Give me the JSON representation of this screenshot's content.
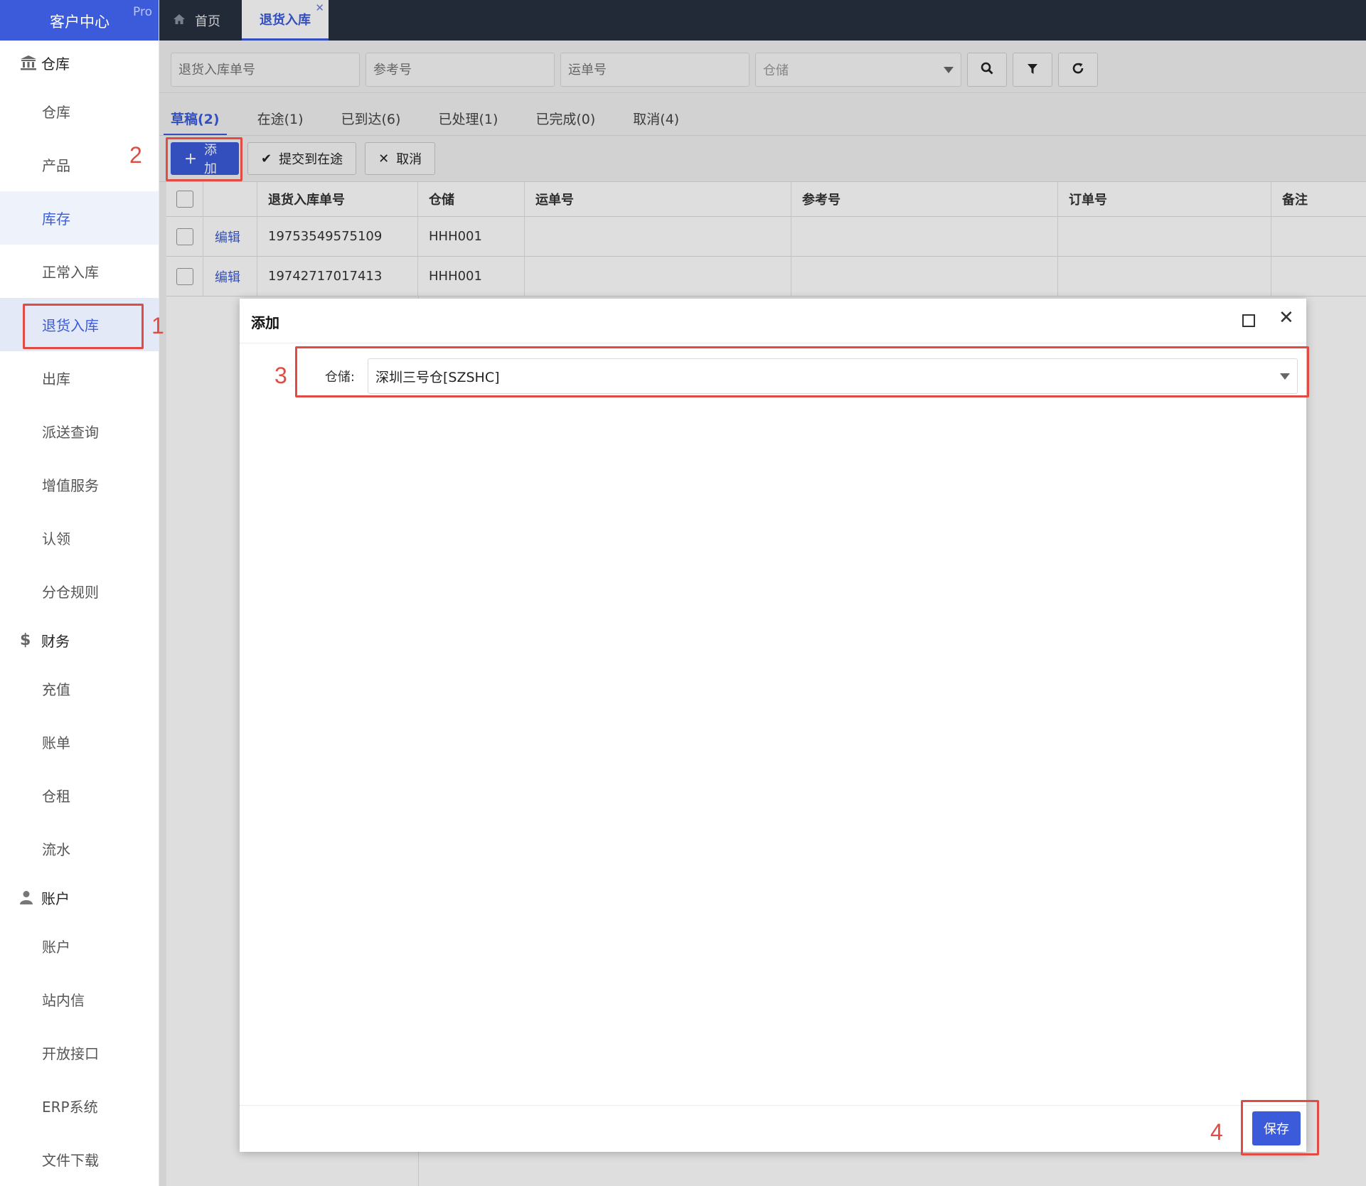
{
  "brand": {
    "title": "客户中心",
    "badge": "Pro"
  },
  "sidebar": {
    "groups": [
      {
        "label": "仓库",
        "icon": "bank-icon",
        "items": [
          "仓库",
          "产品",
          "库存",
          "正常入库",
          "退货入库",
          "出库",
          "派送查询",
          "增值服务",
          "认领",
          "分仓规则"
        ]
      },
      {
        "label": "财务",
        "icon": "dollar-icon",
        "items": [
          "充值",
          "账单",
          "仓租",
          "流水"
        ]
      },
      {
        "label": "账户",
        "icon": "user-icon",
        "items": [
          "账户",
          "站内信",
          "开放接口",
          "ERP系统",
          "文件下载"
        ]
      }
    ]
  },
  "tabs": {
    "home": "首页",
    "current": "退货入库"
  },
  "filters": {
    "return_no_placeholder": "退货入库单号",
    "ref_placeholder": "参考号",
    "tracking_placeholder": "运单号",
    "warehouse_placeholder": "仓储"
  },
  "status_tabs": [
    "草稿(2)",
    "在途(1)",
    "已到达(6)",
    "已处理(1)",
    "已完成(0)",
    "取消(4)"
  ],
  "actions": {
    "add": "添加",
    "submit": "提交到在途",
    "cancel": "取消"
  },
  "table": {
    "headers": {
      "return_no": "退货入库单号",
      "warehouse": "仓储",
      "tracking": "运单号",
      "ref": "参考号",
      "order": "订单号",
      "note": "备注"
    },
    "edit_label": "编辑",
    "rows": [
      {
        "return_no": "19753549575109",
        "warehouse": "HHH001"
      },
      {
        "return_no": "19742717017413",
        "warehouse": "HHH001"
      }
    ]
  },
  "dialog": {
    "title": "添加",
    "field_label": "仓储:",
    "field_value": "深圳三号仓[SZSHC]",
    "save": "保存"
  },
  "annotations": {
    "step1": "1",
    "step2": "2",
    "step3": "3",
    "step4": "4",
    "color": "#e04b43"
  },
  "colors": {
    "primary": "#3b5bdb",
    "topbar": "#283040"
  }
}
